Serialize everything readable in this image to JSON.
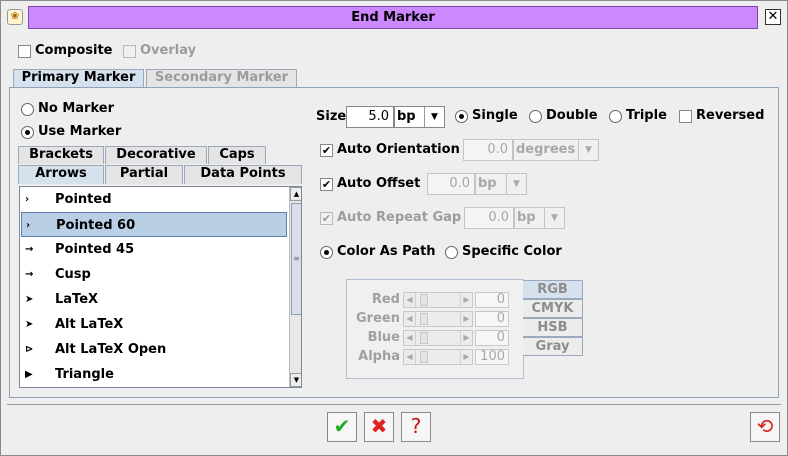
{
  "window": {
    "title": "End Marker",
    "close_glyph": "✕",
    "app_icon_glyph": "❀"
  },
  "options": {
    "composite": "Composite",
    "overlay": "Overlay"
  },
  "tabs": {
    "primary": "Primary Marker",
    "secondary": "Secondary Marker"
  },
  "marker": {
    "no_marker": "No Marker",
    "use_marker": "Use Marker"
  },
  "category_tabs": {
    "row1": [
      "Brackets",
      "Decorative",
      "Caps"
    ],
    "row2": [
      "Arrows",
      "Partial",
      "Data Points"
    ]
  },
  "arrow_list": [
    {
      "label": "Pointed",
      "icon": "›"
    },
    {
      "label": "Pointed 60",
      "icon": "›"
    },
    {
      "label": "Pointed 45",
      "icon": "→"
    },
    {
      "label": "Cusp",
      "icon": "→"
    },
    {
      "label": "LaTeX",
      "icon": "➤"
    },
    {
      "label": "Alt LaTeX",
      "icon": "➤"
    },
    {
      "label": "Alt LaTeX Open",
      "icon": "⊳"
    },
    {
      "label": "Triangle",
      "icon": "▶"
    }
  ],
  "selected_item": "Pointed 60",
  "size": {
    "label": "Size",
    "value": "5.0",
    "unit": "bp"
  },
  "multiplicity": {
    "single": "Single",
    "double": "Double",
    "triple": "Triple",
    "reversed": "Reversed"
  },
  "orientation": {
    "label": "Auto Orientation",
    "value": "0.0",
    "unit": "degrees"
  },
  "offset": {
    "label": "Auto Offset",
    "value": "0.0",
    "unit": "bp"
  },
  "repeat_gap": {
    "label": "Auto Repeat Gap",
    "value": "0.0",
    "unit": "bp"
  },
  "color": {
    "as_path": "Color As Path",
    "specific": "Specific Color",
    "channels": [
      {
        "label": "Red",
        "value": "0"
      },
      {
        "label": "Green",
        "value": "0"
      },
      {
        "label": "Blue",
        "value": "0"
      },
      {
        "label": "Alpha",
        "value": "100"
      }
    ],
    "models": [
      "RGB",
      "CMYK",
      "HSB",
      "Gray"
    ]
  },
  "buttons": {
    "ok": "✔",
    "cancel": "✖",
    "help": "?",
    "reset": "⟲"
  },
  "colors": {
    "title_bar": "#cc88ff",
    "ok_green": "#22aa22",
    "cancel_red": "#dd2222",
    "reset_red": "#dd2222"
  }
}
